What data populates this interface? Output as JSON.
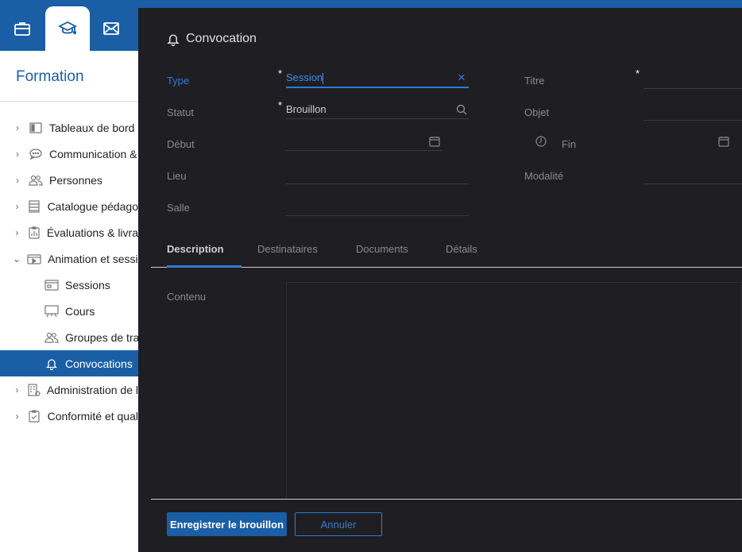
{
  "topbar": {
    "tabs": [
      {
        "icon": "briefcase-icon",
        "active": false
      },
      {
        "icon": "graduation-cap-icon",
        "active": true
      },
      {
        "icon": "envelope-icon",
        "active": false
      }
    ]
  },
  "sidebar": {
    "title": "Formation",
    "items": [
      {
        "label": "Tableaux de bord",
        "icon": "dashboard-icon",
        "expandable": true
      },
      {
        "label": "Communication &",
        "icon": "chat-icon",
        "expandable": true
      },
      {
        "label": "Personnes",
        "icon": "people-icon",
        "expandable": true
      },
      {
        "label": "Catalogue pédago",
        "icon": "catalog-icon",
        "expandable": true
      },
      {
        "label": "Évaluations & livra",
        "icon": "chart-report-icon",
        "expandable": true
      },
      {
        "label": "Animation et sessio",
        "icon": "video-icon",
        "expandable": true,
        "expanded": true
      },
      {
        "label": "Sessions",
        "icon": "calendar-card-icon",
        "sub": true
      },
      {
        "label": "Cours",
        "icon": "easel-icon",
        "sub": true
      },
      {
        "label": "Groupes de trav",
        "icon": "people-icon",
        "sub": true
      },
      {
        "label": "Convocations",
        "icon": "bell-icon",
        "sub": true,
        "active": true
      },
      {
        "label": "Administration de l",
        "icon": "building-gear-icon",
        "expandable": true
      },
      {
        "label": "Conformité et qual",
        "icon": "clipboard-check-icon",
        "expandable": true
      }
    ]
  },
  "modal": {
    "title": "Convocation",
    "title_icon": "bell-icon",
    "fields": {
      "type": {
        "label": "Type",
        "value": "Session",
        "required": true
      },
      "statut": {
        "label": "Statut",
        "value": "Brouillon",
        "required": true
      },
      "debut": {
        "label": "Début",
        "value": ""
      },
      "lieu": {
        "label": "Lieu",
        "value": ""
      },
      "salle": {
        "label": "Salle",
        "value": ""
      },
      "titre": {
        "label": "Titre",
        "value": "",
        "required": true
      },
      "objet": {
        "label": "Objet",
        "value": ""
      },
      "fin": {
        "label": "Fin",
        "value": ""
      },
      "modalite": {
        "label": "Modalité",
        "value": ""
      }
    },
    "tabs": [
      "Description",
      "Destinataires",
      "Documents",
      "Détails"
    ],
    "active_tab": "Description",
    "content_label": "Contenu",
    "buttons": {
      "save_draft": "Enregistrer le brouillon",
      "cancel": "Annuler"
    }
  },
  "colors": {
    "brand": "#1a5ea6",
    "accent": "#2f7ad6",
    "modal_bg": "#1f1f23"
  }
}
